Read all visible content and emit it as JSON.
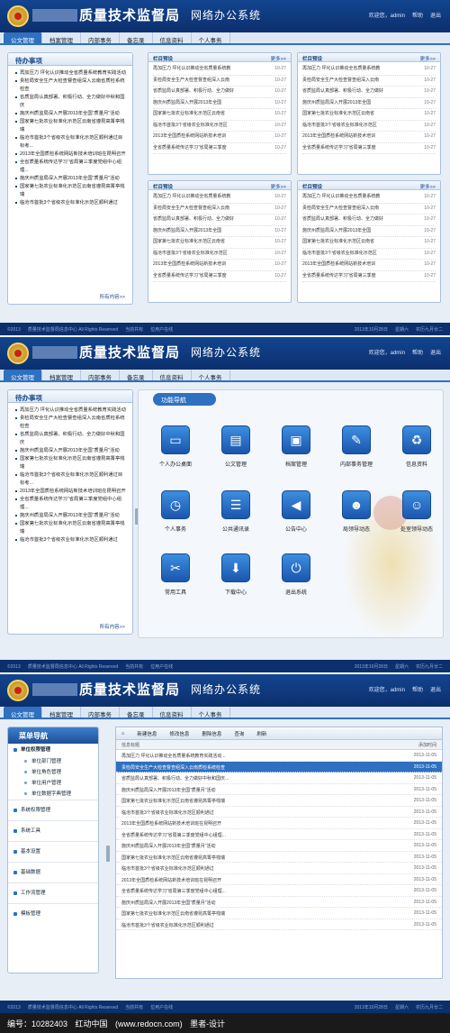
{
  "brand": {
    "bureau": "质量技术监督局",
    "system": "网络办公系统",
    "user": "欢迎您，admin",
    "help": "帮助",
    "logout": "退出"
  },
  "nav": [
    "公文管理",
    "档案管理",
    "内部事务",
    "备忘录",
    "信息资料",
    "个人事务"
  ],
  "footer": {
    "copyright": "©2013",
    "org": "质量技术监督局信息中心 All Rights Reserved",
    "support": "当前共有",
    "online": "位用户在线",
    "date": "2013年10月28日",
    "weekday": "星期六",
    "lunar": "农历九月廿二"
  },
  "todo": {
    "title": "待办事项",
    "more": "所有内容>>",
    "items": [
      "再加压力 坪化认识推动全省质量系统教育实践活动",
      "贵检局安全生产大检查督查组深入云南省质检系统检查",
      "省质监局认真部署、积极行动、全力做好中秋和国庆",
      "施庆州质监局深入开展2013年全国“质量月”活动",
      "国家第七批农业标准化示范区云南省遵昆高箐亭栈瑞",
      "临沧市首批3个省级农业标准化示范区顺利通过目标考...",
      "2013年全国质检系统网站新技术培训班在昆明召开",
      "全省质量系统传达学习“省局第三季度党组中心组理...",
      "施庆州质监局深入开展2013年全国“质量月”活动",
      "国家第七批农业标准化示范区云南省遵昆高箐亭栈瑞",
      "临沧市首批3个省级农业标准化示范区顺利通过"
    ]
  },
  "column": {
    "title": "栏目预设",
    "more": "更多>>",
    "date": "10-27",
    "items": [
      "再加压力 坪化认识推动全省质量系统教",
      "贵检局安全生产大检查督查组深入云南",
      "省质监局认真部署、积极行动、全力做好",
      "施庆州质监局深入开展2013年全国",
      "国家第七批农业标准化示范区云南省",
      "临沧市首批3个省级农业标准化示范区",
      "2013年全国质检系统网站新技术培训",
      "全省质量系统传达学习“省局第三季度"
    ]
  },
  "functions": {
    "title": "功能导航",
    "items": [
      {
        "label": "个人办公桌面",
        "icon": "monitor-icon",
        "glyph": "▭"
      },
      {
        "label": "公文管理",
        "icon": "briefcase-icon",
        "glyph": "▤"
      },
      {
        "label": "档案管理",
        "icon": "archive-icon",
        "glyph": "▣"
      },
      {
        "label": "内部事务管理",
        "icon": "pen-icon",
        "glyph": "✎"
      },
      {
        "label": "信息资料",
        "icon": "recycle-icon",
        "glyph": "♻"
      },
      {
        "label": "个人事务",
        "icon": "clock-icon",
        "glyph": "◷"
      },
      {
        "label": "公共通讯录",
        "icon": "address-book-icon",
        "glyph": "☰"
      },
      {
        "label": "公告中心",
        "icon": "speaker-icon",
        "glyph": "◀"
      },
      {
        "label": "局领导动态",
        "icon": "person-icon",
        "glyph": "☻"
      },
      {
        "label": "处室领导动态",
        "icon": "people-icon",
        "glyph": "☺"
      },
      {
        "label": "常用工具",
        "icon": "tools-icon",
        "glyph": "✂"
      },
      {
        "label": "下载中心",
        "icon": "download-icon",
        "glyph": "⬇"
      },
      {
        "label": "退出系统",
        "icon": "power-icon",
        "glyph": "⏻"
      }
    ]
  },
  "menu": {
    "title": "菜单导航",
    "items": [
      {
        "label": "单位权限管理",
        "kind": "top"
      },
      {
        "label": "单位部门管理",
        "kind": "sub"
      },
      {
        "label": "单位角色管理",
        "kind": "sub"
      },
      {
        "label": "单位用户管理",
        "kind": "sub"
      },
      {
        "label": "单位数据字典管理",
        "kind": "sub"
      },
      {
        "label": "系统权限管理",
        "kind": "sec"
      },
      {
        "label": "系统工具",
        "kind": "sec"
      },
      {
        "label": "基本设置",
        "kind": "sec"
      },
      {
        "label": "基础数据",
        "kind": "sec"
      },
      {
        "label": "工作流管理",
        "kind": "sec"
      },
      {
        "label": "模板管理",
        "kind": "sec"
      }
    ]
  },
  "toolbar": [
    "新建信息",
    "修改信息",
    "删除信息",
    "查询",
    "刷新"
  ],
  "table": {
    "col_title": "信息标题",
    "col_date": "添加时间",
    "date": "2013-11-05",
    "rows": [
      "再加压力 坪化认识推动全省质量系统教育实践活动...",
      "贵检局安全生产大检查督查组深入云南质检系统检查",
      "省质监局认真部署、积极行动、全力做好中秋和国庆...",
      "施庆州质监局深入开展2013年全国“质量月”活动",
      "国家第七批农业标准化示范区云南省遵昆高箐亭栈瑞",
      "临沧市首批3个省级农业标准化示范区顺利通过",
      "2013年全国质检系统网站新技术培训班在昆明召开",
      "全省质量系统传达学习“省局第三季度党组中心组理...",
      "施庆州质监局深入开展2013年全国“质量月”活动",
      "国家第七批农业标准化示范区云南省遵昆高箐亭栈瑞",
      "临沧市首批3个省级农业标准化示范区顺利通过",
      "2013年全国质检系统网站新技术培训班在昆明召开",
      "全省质量系统传达学习“省局第三季度党组中心组理...",
      "施庆州质监局深入开展2013年全国“质量月”活动",
      "国家第七批农业标准化示范区云南省遵昆高箐亭栈瑞",
      "临沧市首批3个省级农业标准化示范区顺利通过"
    ]
  },
  "watermark": "编号：10282403   红动中国 (www.redocn.com)   墨者-设计"
}
